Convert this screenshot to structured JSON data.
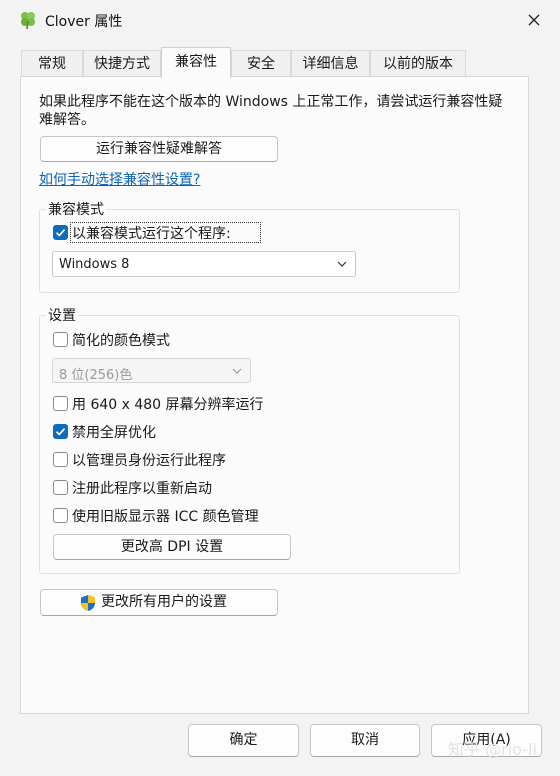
{
  "window": {
    "title": "Clover 属性",
    "app_icon": "clover-icon",
    "close_icon": "close-icon"
  },
  "tabs": [
    {
      "label": "常规",
      "active": false
    },
    {
      "label": "快捷方式",
      "active": false
    },
    {
      "label": "兼容性",
      "active": true
    },
    {
      "label": "安全",
      "active": false
    },
    {
      "label": "详细信息",
      "active": false
    },
    {
      "label": "以前的版本",
      "active": false
    }
  ],
  "intro": "如果此程序不能在这个版本的 Windows 上正常工作，请尝试运行兼容性疑难解答。",
  "troubleshooter_button": "运行兼容性疑难解答",
  "manual_link": "如何手动选择兼容性设置?",
  "compat_mode": {
    "title": "兼容模式",
    "checkbox_label": "以兼容模式运行这个程序:",
    "checked": true,
    "os_selected": "Windows 8"
  },
  "settings": {
    "title": "设置",
    "reduced_color": {
      "label": "简化的颜色模式",
      "checked": false
    },
    "color_select": "8 位(256)色",
    "options": [
      {
        "label": "用 640 x 480 屏幕分辨率运行",
        "checked": false
      },
      {
        "label": "禁用全屏优化",
        "checked": true
      },
      {
        "label": "以管理员身份运行此程序",
        "checked": false
      },
      {
        "label": "注册此程序以重新启动",
        "checked": false
      },
      {
        "label": "使用旧版显示器 ICC 颜色管理",
        "checked": false
      }
    ],
    "dpi_button": "更改高 DPI 设置"
  },
  "all_users_button": "更改所有用户的设置",
  "footer": {
    "ok": "确定",
    "cancel": "取消",
    "apply": "应用(A)"
  },
  "watermark": "知乎 @rio-li",
  "colors": {
    "accent": "#0f6cbd",
    "link": "#0b64b8"
  }
}
